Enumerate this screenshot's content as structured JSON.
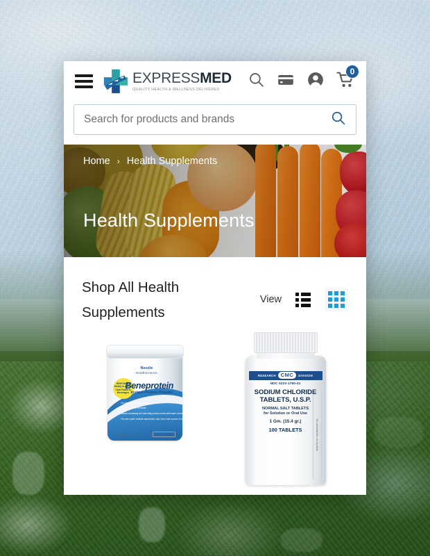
{
  "header": {
    "menu_label": "Menu",
    "logo": {
      "name_part1": "EXPRESS",
      "name_part2": "MED",
      "tagline": "QUALITY HEALTH & WELLNESS DELIVERED"
    },
    "icons": {
      "search": "search-icon",
      "card": "credit-card-icon",
      "account": "account-icon",
      "cart": "cart-icon"
    },
    "cart_count": "0"
  },
  "search": {
    "placeholder": "Search for products and brands",
    "value": "",
    "submit_icon": "search-icon"
  },
  "hero": {
    "breadcrumb": [
      {
        "label": "Home"
      },
      {
        "label": "Health Supplements"
      }
    ],
    "breadcrumb_separator": "›",
    "title": "Health Supplements"
  },
  "shop": {
    "title": "Shop All Health Supplements",
    "view_label": "View",
    "view_options": [
      {
        "name": "list-view",
        "icon": "list-icon",
        "active": false
      },
      {
        "name": "grid-view",
        "icon": "grid-icon",
        "active": true
      }
    ]
  },
  "products": [
    {
      "name": "beneprotein-instant-protein-powder",
      "brand_top": "Nestle",
      "brand_sub": "HealthScience",
      "title": "Beneprotein",
      "subtitle": "Instant Protein Powder",
      "badge": "NEW! Mixes Easily in Hot or Cold Foods & Beverages",
      "bullets": [
        "No carbohydrates or lactose",
        "No protein odor and taste",
        "Allows increasing the total daily protein needs with lower volume"
      ],
      "bullet_note": "For use under medical supervision only. Not a sole source of weight management.",
      "net_weight": "NET WT 8 oz (227 g)",
      "flavor": "UNFLAVORED"
    },
    {
      "name": "sodium-chloride-tablets-usp",
      "banner_left": "RESEARCH",
      "banner_center": "CMC",
      "banner_right": "DIVISION",
      "ndc": "NDC 0223-1760-01",
      "title_line1": "SODIUM CHLORIDE",
      "title_line2": "TABLETS, U.S.P.",
      "subtitle_line1": "NORMAL SALT TABLETS",
      "subtitle_line2": "for Solution or Oral Use",
      "strength": "1 Gm. (15.4 gr.)",
      "count": "100 TABLETS",
      "side_text": "Recommended for use by adults"
    }
  ],
  "colors": {
    "brand_blue": "#1f5f9e",
    "brand_teal": "#2aa7a3",
    "accent_cyan": "#1b9dd9",
    "text_dark": "#222222",
    "hero_overlay": "#140e06"
  }
}
